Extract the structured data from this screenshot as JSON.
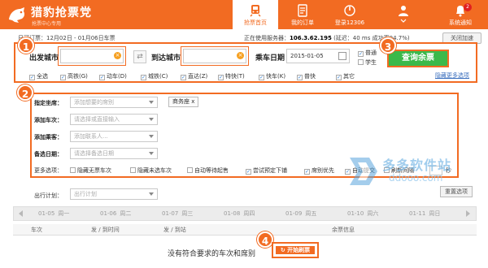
{
  "app": {
    "brand": "猎豹抢票党",
    "brand_sub": "抢票中心专用"
  },
  "nav": [
    {
      "label": "抢票首页",
      "icon": "train-icon",
      "active": true
    },
    {
      "label": "我的订单",
      "icon": "order-list-icon",
      "active": false
    },
    {
      "label": "登录12306",
      "icon": "login-icon",
      "active": false
    },
    {
      "label": "",
      "icon": "user-icon",
      "active": false
    },
    {
      "label": "系统通知",
      "icon": "bell-icon",
      "active": false,
      "badge": "2"
    }
  ],
  "info": {
    "presale": "日可订票：12月02日 - 01月06日车票",
    "server": "正在使用服务器：",
    "server_ip": "106.3.62.195",
    "latency": "(延迟：40 ms",
    "success": "成功率94.7%)",
    "close_accel": "关闭加速"
  },
  "search": {
    "from_label": "出发城市",
    "from_value": "",
    "to_label": "到达城市",
    "to_value": "",
    "date_label": "乘车日期",
    "date_value": "2015-01-05",
    "ticket_types": [
      "普通",
      "学生"
    ],
    "query_button": "查询余票"
  },
  "train_filters": [
    {
      "label": "全选",
      "checked": true
    },
    {
      "label": "高铁(G)",
      "checked": true
    },
    {
      "label": "动车(D)",
      "checked": true
    },
    {
      "label": "城铁(C)",
      "checked": true
    },
    {
      "label": "直达(Z)",
      "checked": true
    },
    {
      "label": "特快(T)",
      "checked": true
    },
    {
      "label": "快车(K)",
      "checked": true
    },
    {
      "label": "普快",
      "checked": true
    },
    {
      "label": "其它",
      "checked": true
    }
  ],
  "hide_more": "隐藏更多选项",
  "options": {
    "seat_label": "指定坐席：",
    "seat_placeholder": "添加想要的席别",
    "seat_chip": "商务座",
    "train_label": "添加车次：",
    "train_placeholder": "请选择或直接输入",
    "passenger_label": "添加乘客：",
    "passenger_placeholder": "添加联系人...",
    "backup_label": "备选日期：",
    "backup_placeholder": "请选择备选日期",
    "more_label": "更多选项：",
    "more_checks": [
      "隐藏无票车次",
      "隐藏未选车次",
      "自动等待起售",
      "尝试预定下铺",
      "席别优先",
      "自动提交",
      "刷新间隔"
    ],
    "refresh_unit": "秒",
    "plan_label": "出行计划：",
    "plan_placeholder": "出行计划",
    "reset_button": "重置选项"
  },
  "dates": [
    {
      "date": "01-05",
      "weekday": "周一"
    },
    {
      "date": "01-06",
      "weekday": "周二"
    },
    {
      "date": "01-07",
      "weekday": "周三"
    },
    {
      "date": "01-08",
      "weekday": "周四"
    },
    {
      "date": "01-09",
      "weekday": "周五"
    },
    {
      "date": "01-10",
      "weekday": "周六"
    },
    {
      "date": "01-11",
      "weekday": "周日"
    }
  ],
  "table": {
    "headers": [
      "车次",
      "发 / 到时间",
      "发 / 到站",
      "余票信息"
    ],
    "empty_text": "没有符合要求的车次和席别",
    "refresh_button": "开始刷票"
  },
  "markers": [
    "1",
    "2",
    "3",
    "4"
  ],
  "watermark": {
    "cn": "多多软件站",
    "url": "ddooo.com"
  },
  "colors": {
    "accent": "#f26b22",
    "query_green": "#3bb94a",
    "link_blue": "#3a6ebd"
  }
}
